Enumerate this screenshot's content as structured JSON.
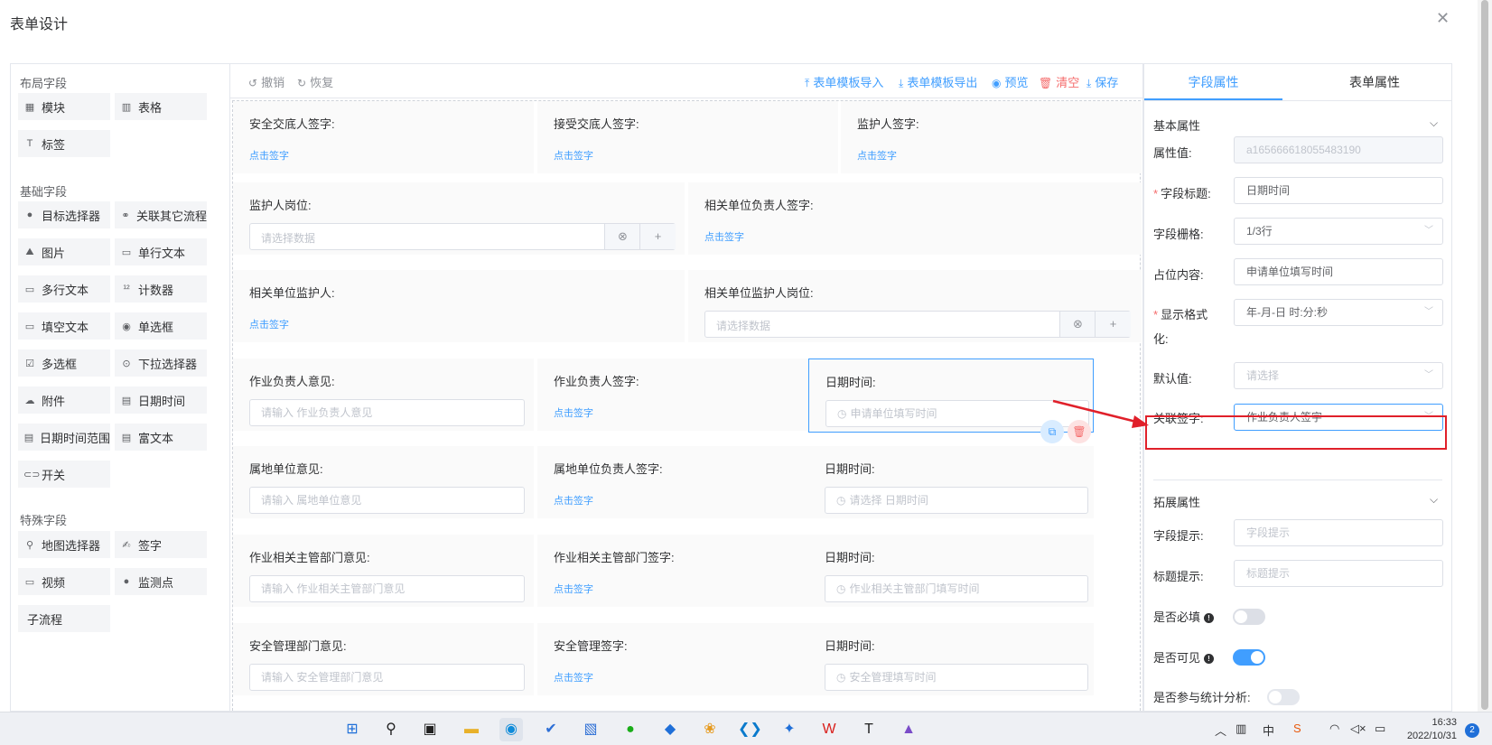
{
  "dialog": {
    "title": "表单设计",
    "close_icon": "close-icon"
  },
  "palette": {
    "layout_group": "布局字段",
    "layout_items": [
      {
        "label": "模块",
        "icon": "grid-icon"
      },
      {
        "label": "表格",
        "icon": "table-icon"
      },
      {
        "label": "标签",
        "icon": "text-t-icon"
      }
    ],
    "basic_group": "基础字段",
    "basic_items": [
      {
        "label": "目标选择器",
        "icon": "person-icon"
      },
      {
        "label": "关联其它流程",
        "icon": "link-icon"
      },
      {
        "label": "图片",
        "icon": "image-icon"
      },
      {
        "label": "单行文本",
        "icon": "single-line-icon"
      },
      {
        "label": "多行文本",
        "icon": "multi-line-icon"
      },
      {
        "label": "计数器",
        "icon": "counter-icon"
      },
      {
        "label": "填空文本",
        "icon": "fill-blank-icon"
      },
      {
        "label": "单选框",
        "icon": "radio-icon"
      },
      {
        "label": "多选框",
        "icon": "checkbox-icon"
      },
      {
        "label": "下拉选择器",
        "icon": "dropdown-icon"
      },
      {
        "label": "附件",
        "icon": "attachment-icon"
      },
      {
        "label": "日期时间",
        "icon": "calendar-icon"
      },
      {
        "label": "日期时间范围",
        "icon": "date-range-icon"
      },
      {
        "label": "富文本",
        "icon": "rich-text-icon"
      },
      {
        "label": "开关",
        "icon": "toggle-icon"
      }
    ],
    "special_group": "特殊字段",
    "special_items": [
      {
        "label": "地图选择器",
        "icon": "map-pin-icon"
      },
      {
        "label": "签字",
        "icon": "signature-icon"
      },
      {
        "label": "视频",
        "icon": "video-icon"
      },
      {
        "label": "监测点",
        "icon": "monitor-point-icon"
      },
      {
        "label": "子流程",
        "icon": ""
      }
    ]
  },
  "toolbar": {
    "undo": "撤销",
    "redo": "恢复",
    "import": "表单模板导入",
    "export": "表单模板导出",
    "preview": "预览",
    "clear": "清空",
    "save": "保存"
  },
  "canvas": {
    "sign_link": "点击签字",
    "rows": [
      [
        {
          "label": "安全交底人签字:",
          "type": "sign"
        },
        {
          "label": "接受交底人签字:",
          "type": "sign"
        },
        {
          "label": "监护人签字:",
          "type": "sign"
        }
      ],
      [
        {
          "label": "监护人岗位:",
          "type": "select",
          "placeholder": "请选择数据"
        },
        {
          "label": "相关单位负责人签字:",
          "type": "sign"
        }
      ],
      [
        {
          "label": "相关单位监护人:",
          "type": "sign"
        },
        {
          "label": "相关单位监护人岗位:",
          "type": "select",
          "placeholder": "请选择数据"
        }
      ],
      [
        {
          "label": "作业负责人意见:",
          "type": "input",
          "placeholder": "请输入 作业负责人意见"
        },
        {
          "label": "作业负责人签字:",
          "type": "sign"
        },
        {
          "label": "日期时间:",
          "type": "date",
          "placeholder": "申请单位填写时间",
          "active": true
        }
      ],
      [
        {
          "label": "属地单位意见:",
          "type": "input",
          "placeholder": "请输入 属地单位意见"
        },
        {
          "label": "属地单位负责人签字:",
          "type": "sign"
        },
        {
          "label": "日期时间:",
          "type": "date",
          "placeholder": "请选择 日期时间"
        }
      ],
      [
        {
          "label": "作业相关主管部门意见:",
          "type": "input",
          "placeholder": "请输入 作业相关主管部门意见"
        },
        {
          "label": "作业相关主管部门签字:",
          "type": "sign"
        },
        {
          "label": "日期时间:",
          "type": "date",
          "placeholder": "作业相关主管部门填写时间"
        }
      ],
      [
        {
          "label": "安全管理部门意见:",
          "type": "input",
          "placeholder": "请输入 安全管理部门意见"
        },
        {
          "label": "安全管理签字:",
          "type": "sign"
        },
        {
          "label": "日期时间:",
          "type": "date",
          "placeholder": "安全管理填写时间"
        }
      ]
    ]
  },
  "props": {
    "tab_field": "字段属性",
    "tab_form": "表单属性",
    "basic_section": "基本属性",
    "attr_value_label": "属性值:",
    "attr_value": "a165666618055483190",
    "field_title_label": "字段标题:",
    "field_title_value": "日期时间",
    "field_grid_label": "字段栅格:",
    "field_grid_value": "1/3行",
    "placeholder_label": "占位内容:",
    "placeholder_value": "申请单位填写时间",
    "format_label": "显示格式化:",
    "format_label_line1": "显示格式",
    "format_label_line2": "化:",
    "format_value": "年-月-日 时:分:秒",
    "default_label": "默认值:",
    "default_placeholder": "请选择",
    "linked_sign_label": "关联签字:",
    "linked_sign_value": "作业负责人签字",
    "ext_section": "拓展属性",
    "hint_label": "字段提示:",
    "hint_placeholder": "字段提示",
    "title_hint_label": "标题提示:",
    "title_hint_placeholder": "标题提示",
    "required_label": "是否必填",
    "required_on": false,
    "visible_label": "是否可见",
    "visible_on": true,
    "stats_label": "是否参与统计分析:",
    "stats_on": false,
    "accent_color": "#409eff",
    "highlight_color": "#e0202a"
  },
  "taskbar": {
    "time": "16:33",
    "date": "2022/10/31",
    "notifications": "2",
    "apps": [
      "windows-start-icon",
      "search-icon",
      "task-view-icon",
      "file-explorer-icon",
      "edge-icon",
      "todo-icon",
      "photos-icon",
      "wechat-icon",
      "app-icon",
      "app-icon",
      "vscode-icon",
      "app-icon",
      "wps-icon",
      "typora-icon",
      "app-icon"
    ],
    "tray": [
      "chevron-up-icon",
      "ime-icon",
      "ime-mode-icon",
      "app-icon",
      "wifi-icon",
      "volume-icon",
      "battery-icon"
    ]
  }
}
